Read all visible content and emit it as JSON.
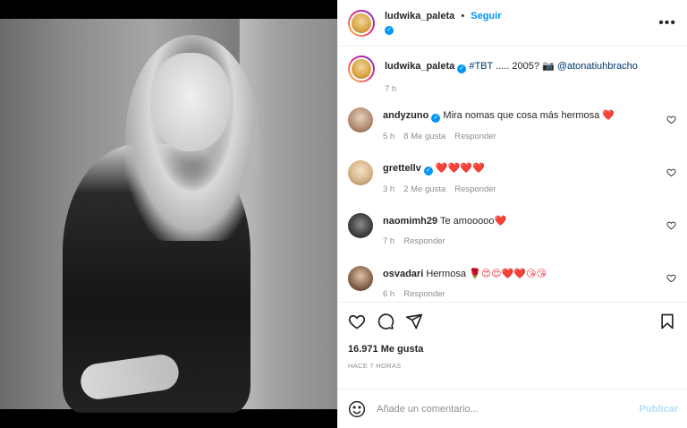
{
  "header": {
    "username": "ludwika_paleta",
    "separator": "•",
    "follow_label": "Seguir",
    "more_icon": "more-horizontal-icon"
  },
  "caption": {
    "username": "ludwika_paleta",
    "text_tag": "#TBT",
    "text_middle": " ..... 2005? 📷 ",
    "text_mention": "@atonatiuhbracho",
    "time": "7 h"
  },
  "comments": [
    {
      "username": "andyzuno",
      "verified": true,
      "text": "Mira nomas que cosa más hermosa ",
      "emoji": "❤️",
      "time": "5 h",
      "likes": "8 Me gusta",
      "reply": "Responder"
    },
    {
      "username": "grettellv",
      "verified": true,
      "text": "",
      "emoji": "❤️❤️❤️❤️",
      "time": "3 h",
      "likes": "2 Me gusta",
      "reply": "Responder"
    },
    {
      "username": "naomimh29",
      "verified": false,
      "text": "Te amooooo",
      "emoji": "❤️",
      "time": "7 h",
      "likes": "",
      "reply": "Responder"
    },
    {
      "username": "osvadari",
      "verified": false,
      "text": "Hermosa ",
      "emoji": "🌹😍😍❤️❤️😘😘",
      "time": "6 h",
      "likes": "",
      "reply": "Responder"
    }
  ],
  "actions": {
    "likes": "16.971 Me gusta",
    "time_ago": "HACE 7 HORAS"
  },
  "add_comment": {
    "placeholder": "Añade un comentario...",
    "post_label": "Publicar"
  },
  "colors": {
    "link": "#0095f6",
    "mention": "#00376b",
    "muted": "#8e8e8e",
    "heart": "#ed4956"
  }
}
